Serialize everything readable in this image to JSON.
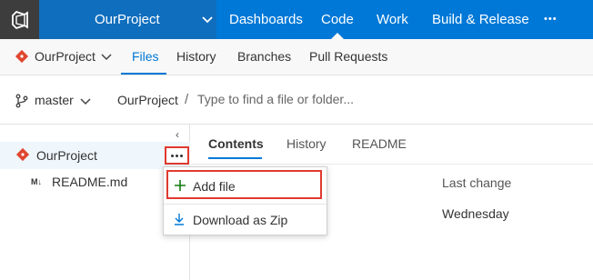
{
  "topbar": {
    "project_name": "OurProject",
    "nav": [
      "Dashboards",
      "Code",
      "Work",
      "Build & Release"
    ],
    "active": "Code",
    "more_label": "•••"
  },
  "subbar": {
    "repo_name": "OurProject",
    "tabs": [
      "Files",
      "History",
      "Branches",
      "Pull Requests"
    ],
    "active": "Files"
  },
  "branchbar": {
    "branch": "master",
    "crumb_root": "OurProject",
    "separator": "/",
    "path_placeholder": "Type to find a file or folder..."
  },
  "tree": {
    "collapse": "‹",
    "items": [
      {
        "label": "OurProject",
        "icon": "git-repo-icon"
      },
      {
        "label": "README.md",
        "icon": "markdown-icon",
        "icon_text": "M↓"
      }
    ]
  },
  "content": {
    "tabs": [
      "Contents",
      "History",
      "README"
    ],
    "active": "Contents",
    "column_header": "Last change",
    "last_change": "Wednesday"
  },
  "context_menu": {
    "items": [
      {
        "label": "Add file",
        "icon": "plus-icon"
      },
      {
        "label": "Download as Zip",
        "icon": "download-icon"
      }
    ]
  },
  "colors": {
    "brand_blue": "#0078d7",
    "highlight_red": "#e03a2f",
    "repo_icon_red": "#e0462f",
    "add_green": "#107c10"
  }
}
